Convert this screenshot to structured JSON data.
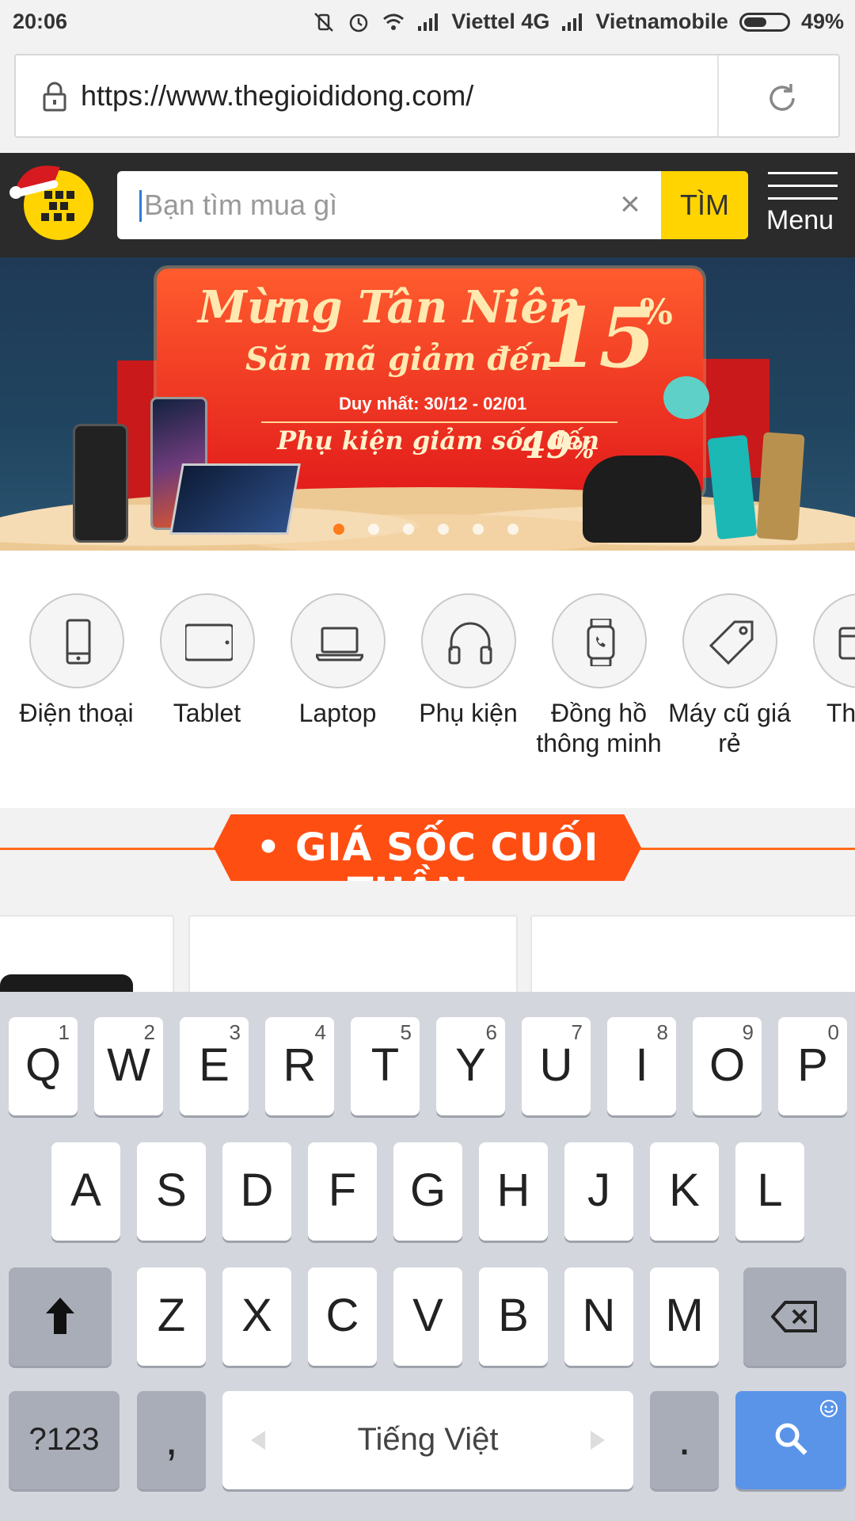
{
  "status_bar": {
    "time": "20:06",
    "carrier1": "Viettel 4G",
    "carrier2": "Vietnamobile",
    "battery": "49%",
    "icons": [
      "mute-vibrate-icon",
      "alarm-icon",
      "wifi-icon",
      "signal-icon",
      "signal-icon",
      "battery-icon"
    ]
  },
  "browser": {
    "url": "https://www.thegioididong.com/",
    "icons": [
      "lock-icon",
      "reload-icon"
    ]
  },
  "header": {
    "search_placeholder": "Bạn tìm mua gì",
    "search_button": "TÌM",
    "menu_label": "Menu",
    "colors": {
      "bar": "#2b2b2b",
      "accent": "#ffd400"
    }
  },
  "banner": {
    "line1": "Mừng Tân Niên",
    "line2": "Săn mã giảm đến",
    "percent": "15",
    "percent_sign": "%",
    "dates": "Duy nhất: 30/12 - 02/01",
    "accessories": "Phụ kiện giảm sốc đến",
    "accessories_pct": "49",
    "accessories_sign": "%",
    "slide_count": 6,
    "active_slide": 0
  },
  "categories": [
    {
      "label": "Điện thoại",
      "icon": "phone-icon"
    },
    {
      "label": "Tablet",
      "icon": "tablet-icon"
    },
    {
      "label": "Laptop",
      "icon": "laptop-icon"
    },
    {
      "label": "Phụ kiện",
      "icon": "headphones-icon"
    },
    {
      "label": "Đồng hồ thông minh",
      "icon": "smartwatch-icon"
    },
    {
      "label": "Máy cũ giá rẻ",
      "icon": "price-tag-icon"
    },
    {
      "label": "Thẻ S",
      "icon": "card-icon"
    }
  ],
  "deals": {
    "title": "GIÁ SỐC CUỐI TUẦN",
    "accent": "#ff4e12"
  },
  "keyboard": {
    "row1": [
      {
        "ch": "Q",
        "num": "1"
      },
      {
        "ch": "W",
        "num": "2"
      },
      {
        "ch": "E",
        "num": "3"
      },
      {
        "ch": "R",
        "num": "4"
      },
      {
        "ch": "T",
        "num": "5"
      },
      {
        "ch": "Y",
        "num": "6"
      },
      {
        "ch": "U",
        "num": "7"
      },
      {
        "ch": "I",
        "num": "8"
      },
      {
        "ch": "O",
        "num": "9"
      },
      {
        "ch": "P",
        "num": "0"
      }
    ],
    "row2": [
      "A",
      "S",
      "D",
      "F",
      "G",
      "H",
      "J",
      "K",
      "L"
    ],
    "row3": [
      "Z",
      "X",
      "C",
      "V",
      "B",
      "N",
      "M"
    ],
    "symbols_key": "?123",
    "comma_key": ",",
    "space_label": "Tiếng Việt",
    "period_key": ".",
    "icons": [
      "shift-icon",
      "backspace-icon",
      "search-icon",
      "emoji-icon"
    ],
    "colors": {
      "action": "#5a94e8"
    }
  }
}
